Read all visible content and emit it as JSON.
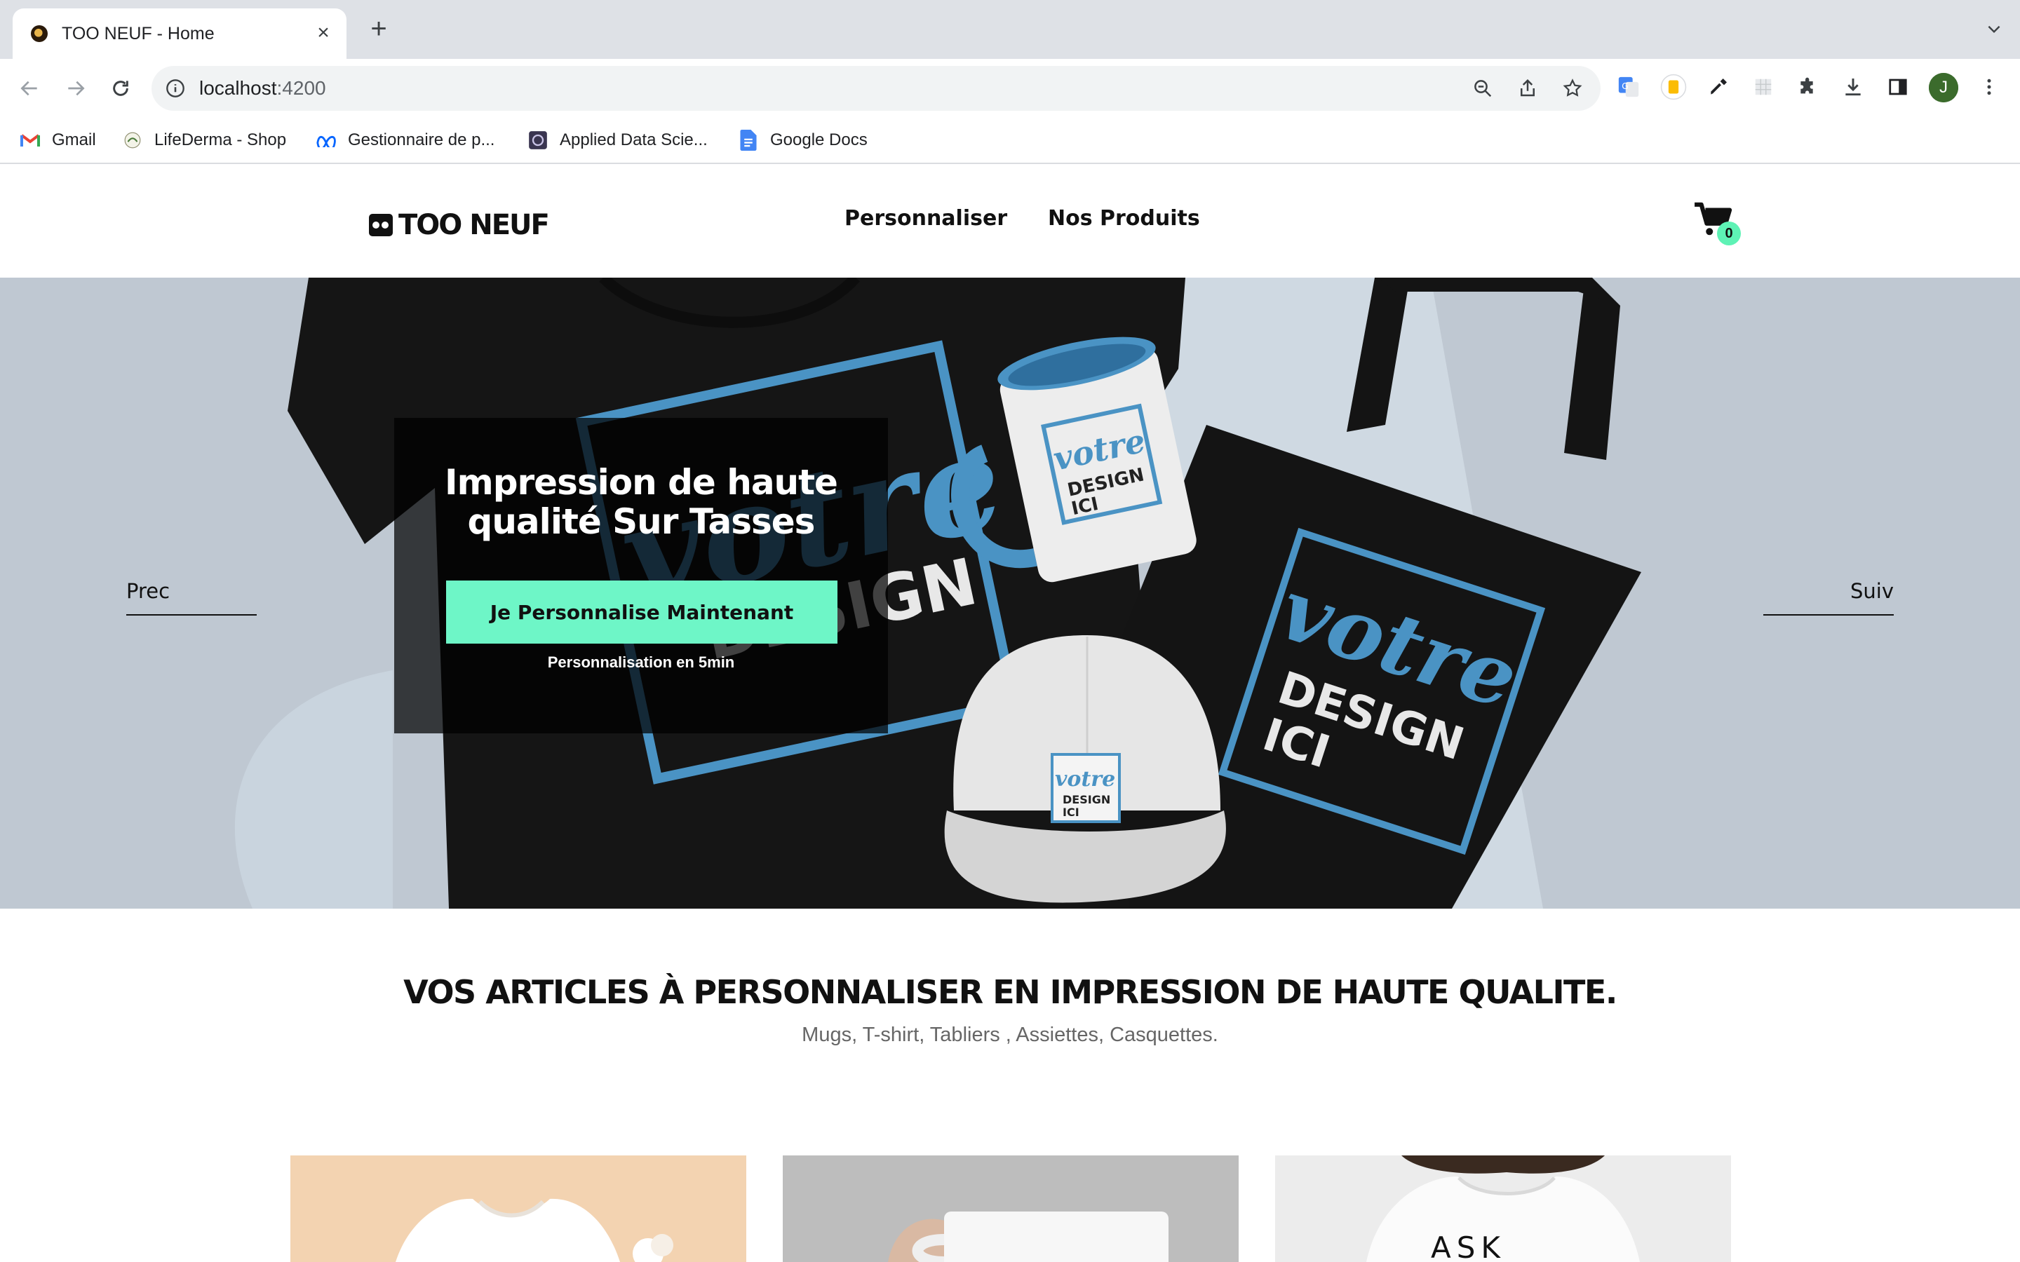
{
  "browser": {
    "tab_title": "TOO NEUF - Home",
    "url_host": "localhost",
    "url_port": ":4200",
    "profile_initial": "J",
    "bookmarks": [
      {
        "label": "Gmail",
        "icon": "gmail-icon"
      },
      {
        "label": "LifeDerma - Shop",
        "icon": "lifederma-icon"
      },
      {
        "label": "Gestionnaire de p...",
        "icon": "meta-icon"
      },
      {
        "label": "Applied Data Scie...",
        "icon": "course-icon"
      },
      {
        "label": "Google Docs",
        "icon": "docs-icon"
      }
    ]
  },
  "site": {
    "logo": "TOO NEUF",
    "nav": [
      "Personnaliser",
      "Nos Produits"
    ],
    "cart_count": "0"
  },
  "hero": {
    "title_line1": "Impression de haute",
    "title_line2": "qualité Sur Tasses",
    "cta": "Je Personnalise Maintenant",
    "subtitle": "Personnalisation en 5min",
    "prev": "Prec",
    "next": "Suiv",
    "print_word": "votre",
    "print_line2": "DESIGN",
    "print_line3": "ICI"
  },
  "section": {
    "title": "VOS ARTICLES À PERSONNALISER EN IMPRESSION DE HAUTE QUALITE.",
    "subtitle": "Mugs, T-shirt, Tabliers , Assiettes, Casquettes."
  },
  "cards": [
    {
      "name": "baby-bodysuit-product",
      "print": ""
    },
    {
      "name": "mug-product",
      "print": ""
    },
    {
      "name": "tshirt-product",
      "print": "ASK"
    }
  ],
  "colors": {
    "accent": "#6ef6c7",
    "badge": "#5ef2b5",
    "hero_bg": "#bfc8d2",
    "print_blue": "#4a93c4"
  }
}
